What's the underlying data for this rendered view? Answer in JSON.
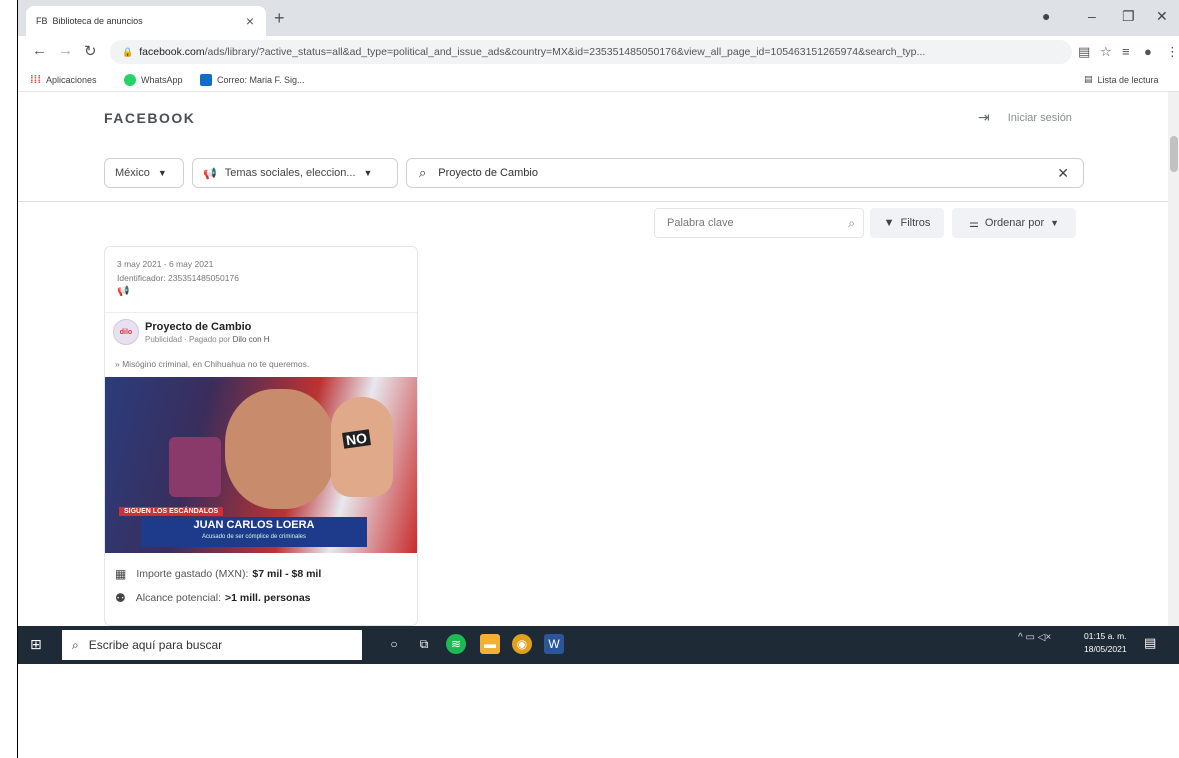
{
  "browser": {
    "tab_title": "Biblioteca de anuncios",
    "tab_favicon": "FB",
    "url_host": "facebook.com",
    "url_path": "/ads/library/?active_status=all&ad_type=political_and_issue_ads&country=MX&id=235351485050176&view_all_page_id=105463151265974&search_typ...",
    "bookmarks": [
      "Aplicaciones",
      "WhatsApp",
      "Correo: Maria F. Sig..."
    ],
    "reading_list": "Lista de lectura"
  },
  "fb": {
    "logo": "FACEBOOK",
    "login": "Iniciar sesión",
    "country": "México",
    "ad_category": "Temas sociales, eleccion...",
    "search_query": "Proyecto de Cambio",
    "keyword_placeholder": "Palabra clave",
    "filters": "Filtros",
    "sort": "Ordenar por"
  },
  "ad": {
    "dates": "3 may 2021 - 6 may 2021",
    "id_line": "Identificador: 235351485050176",
    "advertiser": "Proyecto de Cambio",
    "sponsored_prefix": "Publicidad · Pagado por",
    "paid_by": "Dilo con H",
    "text": "» Misógino criminal, en Chihuahua no te queremos.",
    "image_tag": "SIGUEN LOS ESCÁNDALOS",
    "image_title": "JUAN CARLOS LOERA",
    "image_subtitle": "Acusado de ser cómplice de criminales",
    "image_sign": "NO",
    "spent_label": "Importe gastado (MXN):",
    "spent_value": "$7 mil - $8 mil",
    "reach_label": "Alcance potencial:",
    "reach_value": ">1 mill. personas"
  },
  "taskbar": {
    "search_placeholder": "Escribe aquí para buscar",
    "time": "01:15 a. m.",
    "date": "18/05/2021"
  }
}
